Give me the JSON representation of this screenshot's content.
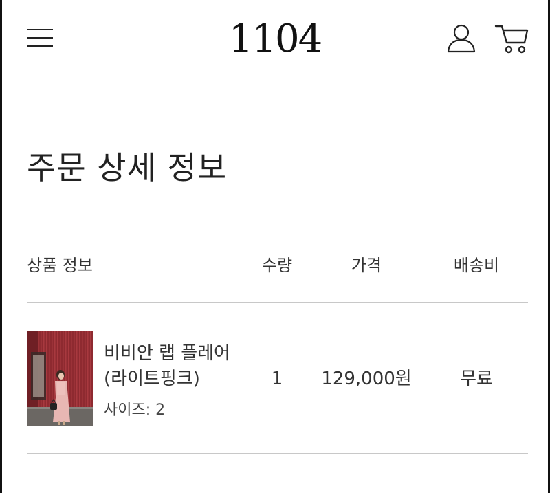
{
  "header": {
    "logo": "1104",
    "icons": {
      "menu": "hamburger-menu-icon",
      "account": "user-icon",
      "cart": "cart-icon"
    }
  },
  "page": {
    "title": "주문 상세 정보"
  },
  "table": {
    "headers": {
      "product": "상품 정보",
      "quantity": "수량",
      "price": "가격",
      "shipping": "배송비"
    },
    "rows": [
      {
        "name_line1": "비비안 랩 플레어",
        "name_line2": "(라이트핑크)",
        "option": "사이즈: 2",
        "quantity": "1",
        "price": "129,000원",
        "shipping": "무료"
      }
    ]
  },
  "colors": {
    "text": "#222222",
    "divider": "#c8c8c8",
    "thumb_wall": "#8e2a30",
    "dress": "#e8b7b3"
  }
}
